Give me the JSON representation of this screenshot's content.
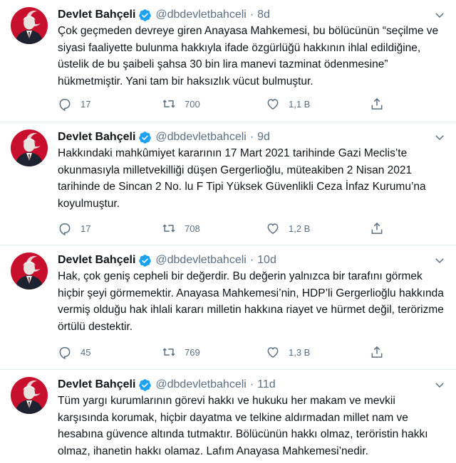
{
  "tweets": [
    {
      "name": "Devlet Bahçeli",
      "handle": "@dbdevletbahceli",
      "separator": "·",
      "time": "8d",
      "text": "Çok geçmeden devreye giren Anayasa Mahkemesi, bu bölücünün “seçilme ve siyasi faaliyette bulunma hakkıyla ifade özgürlüğü hakkının ihlal edildiğine, üstelik de bu şaibeli şahsa 30 bin lira manevi tazminat ödenmesine” hükmetmiştir. Yani tam bir haksızlık vücut bulmuştur.",
      "replies": "17",
      "retweets": "700",
      "likes": "1,1 B"
    },
    {
      "name": "Devlet Bahçeli",
      "handle": "@dbdevletbahceli",
      "separator": "·",
      "time": "9d",
      "text": "Hakkındaki mahkûmiyet kararının 17 Mart 2021 tarihinde Gazi Meclis’te okunmasıyla milletvekilliği düşen Gergerlioğlu, müteakiben 2 Nisan 2021 tarihinde de Sincan 2 No. lu F Tipi Yüksek Güvenlikli Ceza İnfaz Kurumu’na koyulmuştur.",
      "replies": "17",
      "retweets": "708",
      "likes": "1,2 B"
    },
    {
      "name": "Devlet Bahçeli",
      "handle": "@dbdevletbahceli",
      "separator": "·",
      "time": "10d",
      "text": "Hak, çok geniş cepheli bir değerdir. Bu değerin yalnızca bir tarafını görmek hiçbir şeyi görmemektir. Anayasa Mahkemesi’nin, HDP’li Gergerlioğlu hakkında vermiş olduğu hak ihlali kararı milletin hakkına riayet ve hürmet değil, terörizme örtülü destektir.",
      "replies": "45",
      "retweets": "769",
      "likes": "1,3 B"
    },
    {
      "name": "Devlet Bahçeli",
      "handle": "@dbdevletbahceli",
      "separator": "·",
      "time": "11d",
      "text": "Tüm yargı kurumlarının görevi hakkı ve hukuku her makam ve mevkii karşısında korumak, hiçbir dayatma ve telkine aldırmadan millet nam ve hesabına güvence altında tutmaktır. Bölücünün hakkı olmaz, teröristin hakkı olmaz, ihanetin hakkı olamaz. Lafım Anayasa Mahkemesi’nedir.",
      "replies": "",
      "retweets": "",
      "likes": ""
    }
  ],
  "icons": {
    "avatar": "profile-photo",
    "verified": "verified-badge-icon",
    "more": "chevron-down-icon",
    "reply": "reply-icon",
    "retweet": "retweet-icon",
    "like": "heart-icon",
    "share": "share-icon"
  },
  "colors": {
    "verified": "#1da1f2",
    "muted": "#5b7083",
    "avatar_background": "#c8102e",
    "divider": "#e6ecf0"
  }
}
